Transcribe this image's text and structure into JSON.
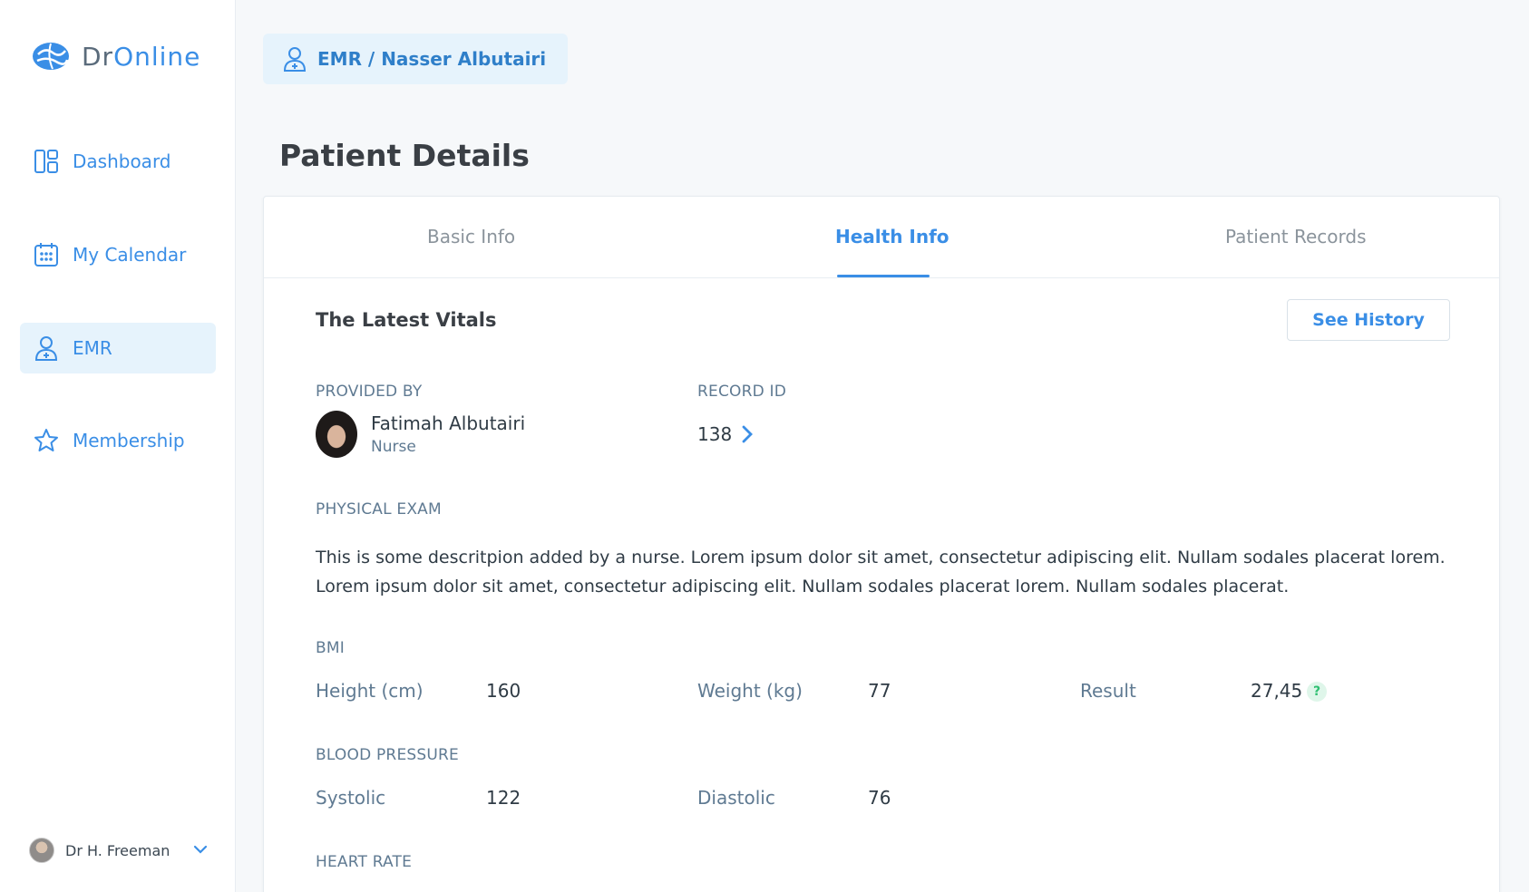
{
  "app": {
    "logo_prefix": "Dr",
    "logo_suffix": "Online"
  },
  "sidebar": {
    "items": [
      {
        "label": "Dashboard",
        "icon": "dashboard-icon"
      },
      {
        "label": "My Calendar",
        "icon": "calendar-icon"
      },
      {
        "label": "EMR",
        "icon": "patient-icon"
      },
      {
        "label": "Membership",
        "icon": "star-icon"
      }
    ],
    "active": "EMR",
    "user_name": "Dr H. Freeman"
  },
  "breadcrumb": "EMR / Nasser Albutairi",
  "page_title": "Patient Details",
  "tabs": [
    {
      "label": "Basic Info"
    },
    {
      "label": "Health Info"
    },
    {
      "label": "Patient Records"
    }
  ],
  "active_tab": "Health Info",
  "vitals": {
    "heading": "The Latest Vitals",
    "see_history_label": "See History",
    "provided_by_label": "PROVIDED BY",
    "provider_name": "Fatimah Albutairi",
    "provider_role": "Nurse",
    "record_id_label": "RECORD ID",
    "record_id": "138",
    "physical_exam_label": "PHYSICAL EXAM",
    "physical_exam_text": "This is some descritpion added by a nurse. Lorem ipsum dolor sit amet, consectetur adipiscing elit. Nullam sodales placerat lorem. Lorem ipsum dolor sit amet, consectetur adipiscing elit. Nullam sodales placerat lorem. Nullam sodales placerat.",
    "bmi": {
      "label": "BMI",
      "height_label": "Height (cm)",
      "height": "160",
      "weight_label": "Weight (kg)",
      "weight": "77",
      "result_label": "Result",
      "result": "27,45",
      "help_symbol": "?"
    },
    "blood_pressure": {
      "label": "BLOOD PRESSURE",
      "systolic_label": "Systolic",
      "systolic": "122",
      "diastolic_label": "Diastolic",
      "diastolic": "76"
    },
    "heart_rate_label": "HEART RATE"
  },
  "colors": {
    "accent": "#3a8ee6",
    "active_bg": "#e6f3fc",
    "label": "#5f7a92",
    "help_green": "#2fbf71"
  }
}
